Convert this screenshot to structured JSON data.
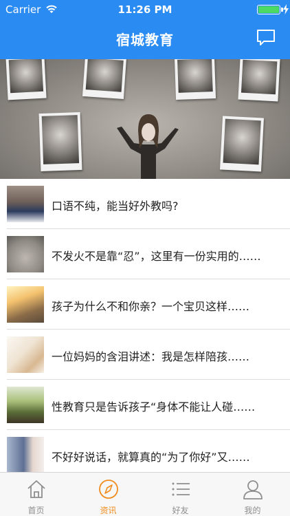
{
  "status_bar": {
    "carrier": "Carrier",
    "time": "11:26 PM"
  },
  "nav": {
    "title": "宿城教育",
    "right_icon": "message-icon"
  },
  "banner": {
    "page_count": 6,
    "active_page": 0
  },
  "articles": [
    {
      "title": "口语不纯，能当好外教吗?"
    },
    {
      "title": "不发火不是靠“忍”，这里有一份实用的……"
    },
    {
      "title": "孩子为什么不和你亲？一个宝贝这样……"
    },
    {
      "title": "一位妈妈的含泪讲述：我是怎样陪孩……"
    },
    {
      "title": "性教育只是告诉孩子“身体不能让人碰……"
    },
    {
      "title": "不好好说话，就算真的“为了你好”又……"
    }
  ],
  "tabs": [
    {
      "label": "首页",
      "icon": "home-icon"
    },
    {
      "label": "资讯",
      "icon": "compass-icon"
    },
    {
      "label": "好友",
      "icon": "list-icon"
    },
    {
      "label": "我的",
      "icon": "person-icon"
    }
  ],
  "colors": {
    "primary": "#2a8bf2",
    "accent": "#f08c1e"
  }
}
